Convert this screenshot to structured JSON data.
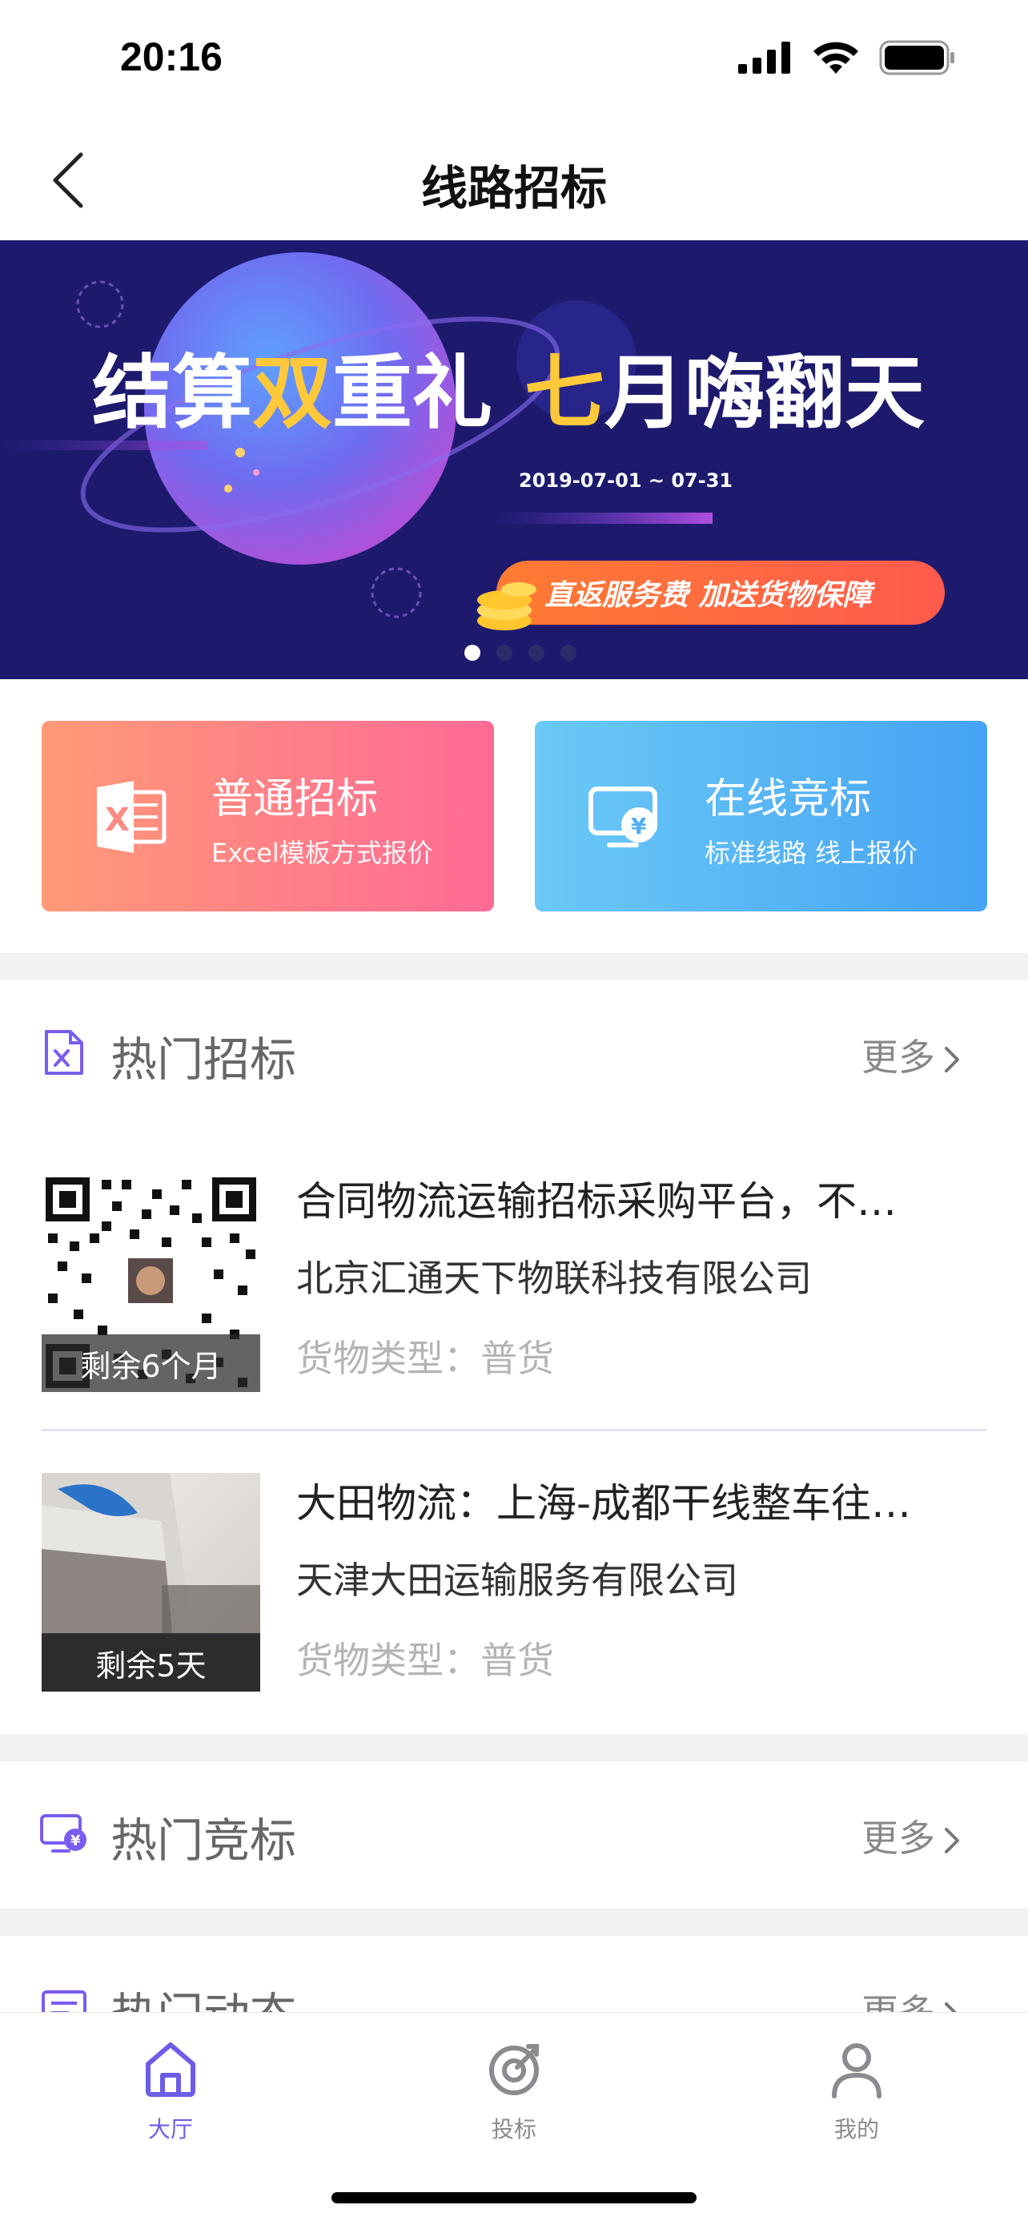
{
  "status_bar": {
    "time": "20:16"
  },
  "nav": {
    "title": "线路招标"
  },
  "banner": {
    "headline_part1": "结算",
    "headline_highlight": "双",
    "headline_part2": "重礼",
    "headline_part3_highlight": "七",
    "headline_part4": "月嗨翻天",
    "date_range": "2019-07-01 ~ 07-31",
    "pill_text": "直返服务费  加送货物保障",
    "slide_count": 4,
    "active_slide": 1
  },
  "cards": [
    {
      "title": "普通招标",
      "subtitle": "Excel模板方式报价",
      "icon": "excel-icon"
    },
    {
      "title": "在线竞标",
      "subtitle": "标准线路 线上报价",
      "icon": "monitor-yen-icon"
    }
  ],
  "hot_tenders": {
    "title": "热门招标",
    "more_label": "更多",
    "items": [
      {
        "title": "合同物流运输招标采购平台，不…",
        "company": "北京汇通天下物联科技有限公司",
        "cargo_type": "货物类型：普货",
        "remaining": "剩余6个月"
      },
      {
        "title": "大田物流：上海-成都干线整车往…",
        "company": "天津大田运输服务有限公司",
        "cargo_type": "货物类型：普货",
        "remaining": "剩余5天"
      }
    ]
  },
  "hot_bids": {
    "title": "热门竞标",
    "more_label": "更多"
  },
  "hot_news": {
    "title": "热门动态",
    "more_label": "更多"
  },
  "tab_bar": {
    "tabs": [
      {
        "label": "大厅",
        "icon": "home-icon",
        "active": true
      },
      {
        "label": "投标",
        "icon": "target-icon",
        "active": false
      },
      {
        "label": "我的",
        "icon": "user-icon",
        "active": false
      }
    ]
  },
  "colors": {
    "accent": "#6c5ce7",
    "card_left_start": "#ff9a78",
    "card_left_end": "#ff6a95",
    "card_right_start": "#6bc9f6",
    "card_right_end": "#45a3f4",
    "banner_bg": "#1d1a6e"
  }
}
